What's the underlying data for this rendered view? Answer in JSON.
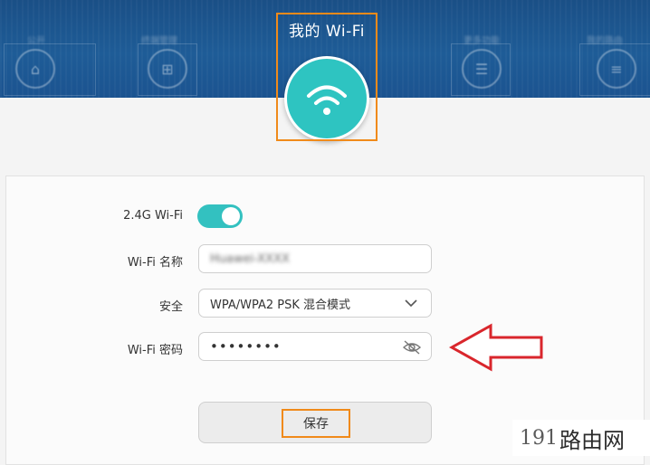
{
  "header": {
    "nav_items": [
      {
        "label": "公开",
        "icon": "home-icon"
      },
      {
        "label": "终端管理",
        "icon": "devices-icon"
      },
      {
        "label": "更多功能",
        "icon": "user-icon"
      },
      {
        "label": "我的路由",
        "icon": "menu-icon"
      }
    ],
    "active": {
      "title": "我的 Wi-Fi",
      "icon": "wifi-icon",
      "color": "#2ec4c1"
    },
    "background_color": "#1e5c97"
  },
  "form": {
    "wifi_24g": {
      "label": "2.4G Wi-Fi",
      "enabled": true
    },
    "ssid": {
      "label": "Wi-Fi 名称",
      "value": "Huawei-XXXX"
    },
    "security": {
      "label": "安全",
      "value": "WPA/WPA2 PSK 混合模式"
    },
    "password": {
      "label": "Wi-Fi 密码",
      "value": "••••••••"
    },
    "save": {
      "label": "保存"
    }
  },
  "annotations": {
    "highlight_color": "#f08a1a",
    "arrow_color": "#d9262c"
  },
  "watermark": {
    "number": "191",
    "text": "路由网"
  }
}
